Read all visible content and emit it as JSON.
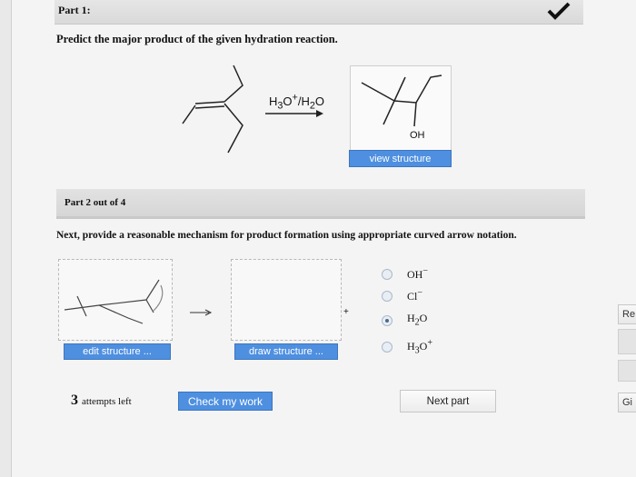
{
  "part1": {
    "label": "Part 1:",
    "question": "Predict the major product of the given hydration reaction.",
    "reagent_html": "H<sub>3</sub>O<sup>+</sup>/H<sub>2</sub>O",
    "product_label": "OH",
    "view_button": "view structure"
  },
  "part2": {
    "label": "Part 2 out of 4",
    "instructions": "Next, provide a reasonable mechanism for product formation using appropriate curved arrow notation.",
    "edit_button": "edit structure ...",
    "draw_button": "draw structure ...",
    "plus_sign": "+",
    "options": [
      {
        "label_html": "OH<sup>−</sup>",
        "selected": false
      },
      {
        "label_html": "Cl<sup>−</sup>",
        "selected": false
      },
      {
        "label_html": "H<sub>2</sub>O",
        "selected": true
      },
      {
        "label_html": "H<sub>3</sub>O<sup>+</sup>",
        "selected": false
      }
    ]
  },
  "footer": {
    "attempts_count": "3",
    "attempts_text": "attempts left",
    "check_button": "Check my work",
    "next_button": "Next part"
  },
  "side": {
    "r_button": "Re",
    "g_button": "Gi"
  },
  "colors": {
    "accent_blue": "#4e8fe0",
    "selected_radio": "#4a6b8c"
  },
  "icons": {
    "check": "checkmark-icon",
    "arrow": "reaction-arrow-icon"
  }
}
